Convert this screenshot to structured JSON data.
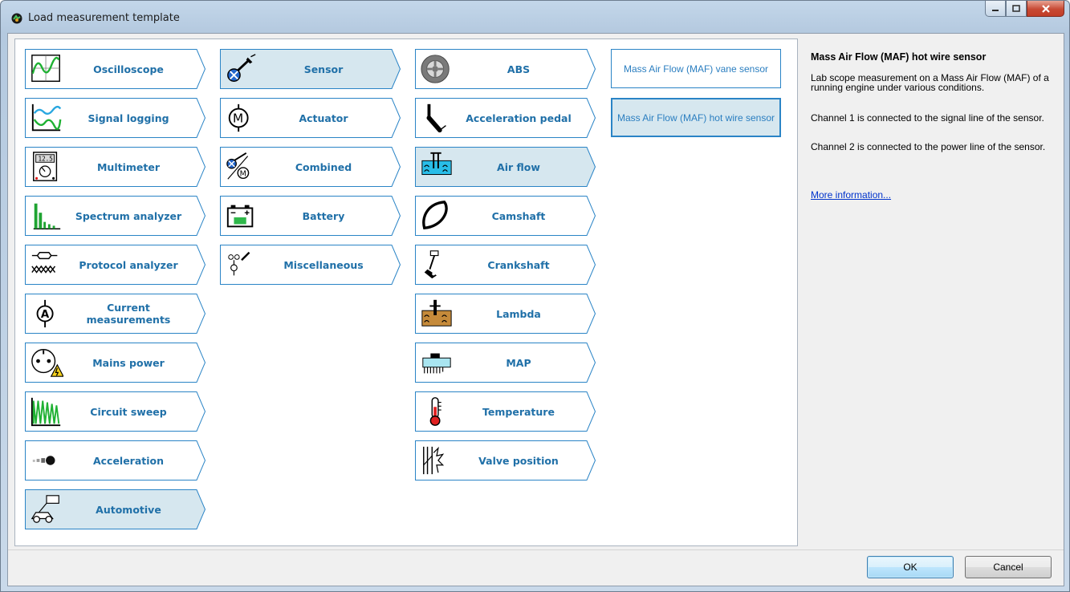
{
  "window": {
    "title": "Load measurement template"
  },
  "categories": [
    {
      "label": "Oscilloscope",
      "icon": "oscilloscope-icon",
      "selected": false
    },
    {
      "label": "Signal logging",
      "icon": "signal-logging-icon",
      "selected": false
    },
    {
      "label": "Multimeter",
      "icon": "multimeter-icon",
      "selected": false
    },
    {
      "label": "Spectrum analyzer",
      "icon": "spectrum-analyzer-icon",
      "selected": false
    },
    {
      "label": "Protocol analyzer",
      "icon": "protocol-analyzer-icon",
      "selected": false
    },
    {
      "label": "Current measurements",
      "icon": "ammeter-icon",
      "selected": false
    },
    {
      "label": "Mains power",
      "icon": "mains-power-icon",
      "selected": false
    },
    {
      "label": "Circuit sweep",
      "icon": "circuit-sweep-icon",
      "selected": false
    },
    {
      "label": "Acceleration",
      "icon": "acceleration-icon",
      "selected": false
    },
    {
      "label": "Automotive",
      "icon": "automotive-icon",
      "selected": true
    }
  ],
  "types": [
    {
      "label": "Sensor",
      "icon": "sensor-icon",
      "selected": true
    },
    {
      "label": "Actuator",
      "icon": "motor-icon",
      "selected": false
    },
    {
      "label": "Combined",
      "icon": "combined-icon",
      "selected": false
    },
    {
      "label": "Battery",
      "icon": "battery-icon",
      "selected": false
    },
    {
      "label": "Miscellaneous",
      "icon": "miscellaneous-icon",
      "selected": false
    }
  ],
  "sensors": [
    {
      "label": "ABS",
      "icon": "abs-wheel-icon",
      "selected": false
    },
    {
      "label": "Acceleration pedal",
      "icon": "pedal-icon",
      "selected": false
    },
    {
      "label": "Air flow",
      "icon": "air-flow-icon",
      "selected": true
    },
    {
      "label": "Camshaft",
      "icon": "camshaft-icon",
      "selected": false
    },
    {
      "label": "Crankshaft",
      "icon": "crankshaft-icon",
      "selected": false
    },
    {
      "label": "Lambda",
      "icon": "lambda-icon",
      "selected": false
    },
    {
      "label": "MAP",
      "icon": "map-icon",
      "selected": false
    },
    {
      "label": "Temperature",
      "icon": "thermometer-icon",
      "selected": false
    },
    {
      "label": "Valve position",
      "icon": "valve-position-icon",
      "selected": false
    }
  ],
  "templates": [
    {
      "label": "Mass Air Flow (MAF) vane sensor",
      "selected": false
    },
    {
      "label": "Mass Air Flow (MAF) hot wire sensor",
      "selected": true
    }
  ],
  "description": {
    "title": "Mass Air Flow (MAF) hot wire sensor",
    "para1": "Lab scope measurement on a Mass Air Flow (MAF) of a running engine under various conditions.",
    "para2": "Channel 1 is connected to the signal line of the sensor.",
    "para3": "Channel 2 is connected to the power line of the sensor.",
    "link": "More information..."
  },
  "buttons": {
    "ok": "OK",
    "cancel": "Cancel"
  },
  "colors": {
    "tile_border": "#2a84c6",
    "tile_selected_bg": "#d6e7ef",
    "label_text": "#2070a8"
  }
}
